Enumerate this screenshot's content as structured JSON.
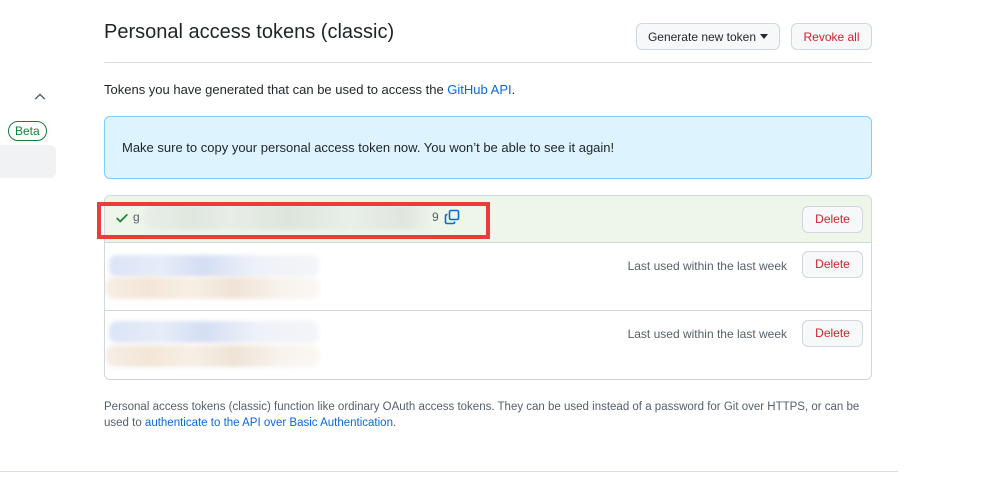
{
  "sidebar": {
    "beta_label": "Beta"
  },
  "header": {
    "title": "Personal access tokens (classic)",
    "generate_label": "Generate new token",
    "revoke_label": "Revoke all"
  },
  "intro": {
    "text": "Tokens you have generated that can be used to access the ",
    "link": "GitHub API",
    "end": "."
  },
  "flash": {
    "message": "Make sure to copy your personal access token now. You won’t be able to see it again!"
  },
  "tokens": [
    {
      "token_start": "g",
      "token_end": "9",
      "delete_label": "Delete"
    },
    {
      "last_used": "Last used within the last week",
      "delete_label": "Delete"
    },
    {
      "last_used": "Last used within the last week",
      "delete_label": "Delete"
    }
  ],
  "footnote": {
    "text": "Personal access tokens (classic) function like ordinary OAuth access tokens. They can be used instead of a password for Git over HTTPS, or can be used to ",
    "link": "authenticate to the API over Basic Authentication",
    "end": "."
  },
  "colors": {
    "danger": "#cf222e",
    "link": "#0969da",
    "success": "#1a7f37",
    "flash_bg": "#ddf4ff",
    "highlight": "#ec3b3b"
  }
}
